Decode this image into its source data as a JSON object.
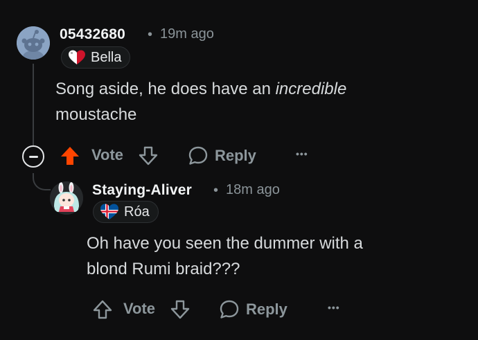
{
  "comments": [
    {
      "username": "05432680",
      "separator": "•",
      "time": "19m ago",
      "flair": "Bella",
      "text_before": "Song aside, he does have an ",
      "text_emphasis": "incredible",
      "text_after": "moustache",
      "vote_label": "Vote",
      "reply_label": "Reply",
      "more_label": "•••",
      "upvoted": true,
      "upvote_color": "#ff4500",
      "avatar_color": "#8ba4c4"
    },
    {
      "username": "Staying-Aliver",
      "separator": "•",
      "time": "18m ago",
      "flair": "Róa",
      "text_line1": "Oh have you seen the dummer with a",
      "text_line2": "blond Rumi braid???",
      "vote_label": "Vote",
      "reply_label": "Reply",
      "more_label": "•••",
      "upvoted": false
    }
  ],
  "colors": {
    "background": "#0e0e0f",
    "muted": "#8d979c",
    "text": "#d7dadc",
    "thread_line": "#3a3d40"
  },
  "icons": {
    "collapse": "minus-circle-icon",
    "upvote": "arrow-up-icon",
    "downvote": "arrow-down-icon",
    "reply": "speech-bubble-icon",
    "more": "ellipsis-icon"
  }
}
